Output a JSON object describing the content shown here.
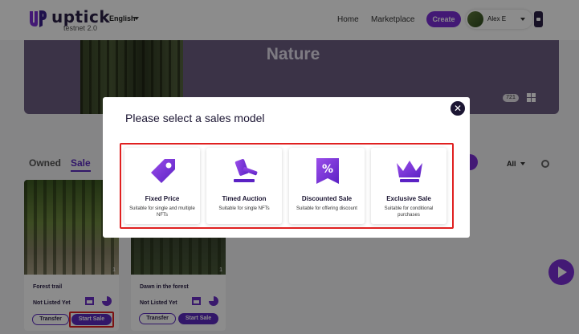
{
  "header": {
    "brand": "uptick",
    "brand_sub": "testnet 2.0",
    "language": "English",
    "nav_home": "Home",
    "nav_marketplace": "Marketplace",
    "create_label": "Create",
    "user_name": "Alex E"
  },
  "banner": {
    "title": "Nature",
    "count": "721"
  },
  "tabs": {
    "owned": "Owned",
    "sale": "Sale"
  },
  "filter": {
    "selected": "All"
  },
  "cards": [
    {
      "title": "Forest trail",
      "status": "Not Listed Yet",
      "number": "1",
      "transfer_label": "Transfer",
      "start_sale_label": "Start Sale"
    },
    {
      "title": "Dawn in the forest",
      "status": "Not Listed Yet",
      "number": "1",
      "transfer_label": "Transfer",
      "start_sale_label": "Start Sale"
    }
  ],
  "modal": {
    "title": "Please select a sales model",
    "close_icon": "close-icon",
    "options": [
      {
        "name": "Fixed Price",
        "description": "Suitable for single and multiple NFTs",
        "icon": "price-tag-icon"
      },
      {
        "name": "Timed Auction",
        "description": "Suitable for single NFTs",
        "icon": "gavel-icon"
      },
      {
        "name": "Discounted Sale",
        "description": "Suitable for offering discount",
        "icon": "percent-badge-icon"
      },
      {
        "name": "Exclusive Sale",
        "description": "Suitable for conditional purchases",
        "icon": "crown-icon"
      }
    ]
  },
  "colors": {
    "accent": "#7b2fd6",
    "highlight": "#e02020"
  }
}
